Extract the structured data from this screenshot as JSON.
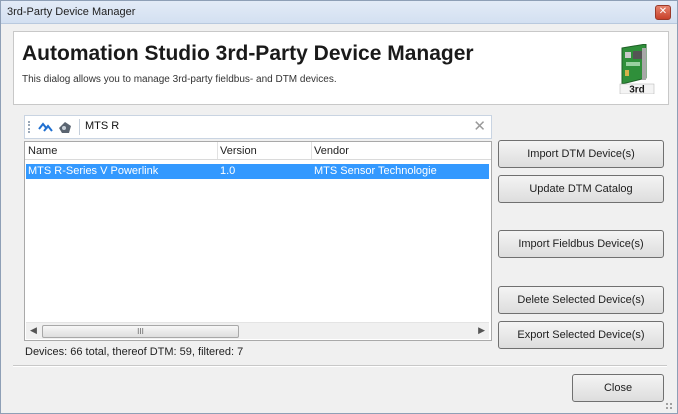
{
  "window": {
    "title": "3rd-Party Device Manager",
    "close_glyph": "✕"
  },
  "header": {
    "title": "Automation Studio 3rd-Party Device Manager",
    "subtitle": "This dialog allows you to manage 3rd-party fieldbus- and DTM devices.",
    "logo_text": "3rd",
    "logo_icon": "pci-card-icon"
  },
  "toolbar": {
    "icons": [
      "refresh-arrows-icon",
      "device-tree-icon"
    ],
    "filter_value": "MTS R",
    "clear_glyph": "✕"
  },
  "grid": {
    "columns": [
      "Name",
      "Version",
      "Vendor"
    ],
    "rows": [
      {
        "name": "MTS R-Series V Powerlink",
        "version": "1.0",
        "vendor": "MTS Sensor Technologie",
        "selected": true
      }
    ],
    "scroll_left": "◀",
    "scroll_right": "▶",
    "thumb_grip": "III"
  },
  "status": "Devices: 66 total, thereof DTM: 59, filtered: 7",
  "buttons": {
    "import_dtm": "Import DTM Device(s)",
    "update_catalog": "Update DTM Catalog",
    "import_fieldbus": "Import Fieldbus Device(s)",
    "delete_selected": "Delete Selected Device(s)",
    "export_selected": "Export Selected Device(s)",
    "close": "Close"
  },
  "colors": {
    "selection": "#3399ff",
    "title_bar": "#dbe6f4",
    "dialog_bg": "#f0f0f0"
  }
}
